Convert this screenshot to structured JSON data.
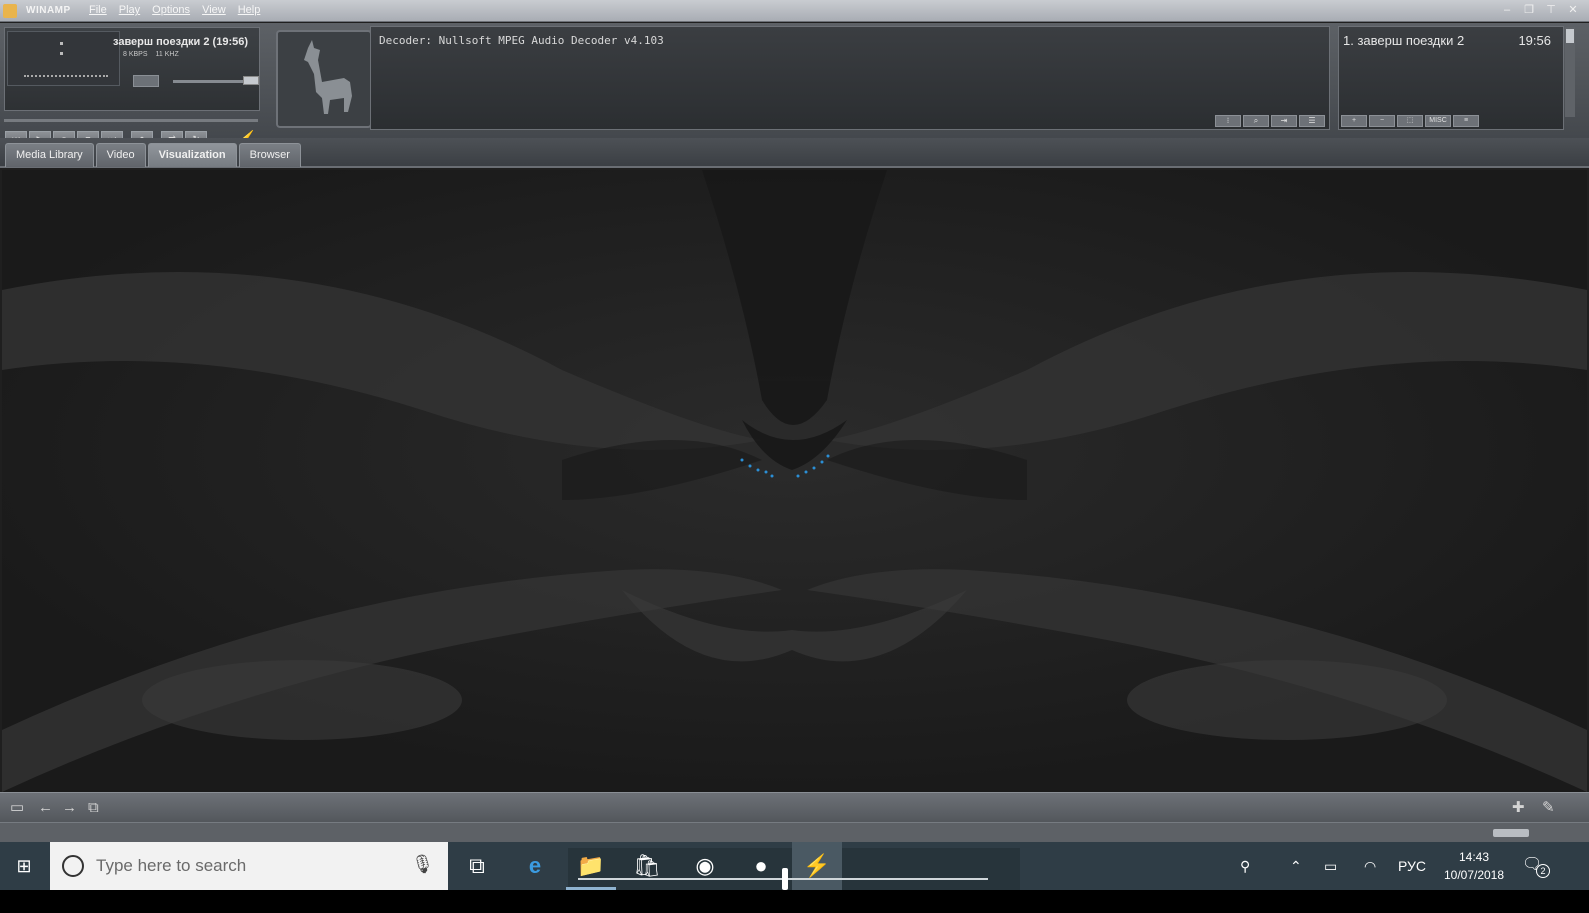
{
  "window": {
    "app_name": "WINAMP",
    "menu": [
      "File",
      "Play",
      "Options",
      "View",
      "Help"
    ]
  },
  "player": {
    "song_title": "заверш поездки 2 (19:56)",
    "kbps": "8 KBPS",
    "khz": "11 KHZ",
    "decoder_text": "Decoder: Nullsoft MPEG Audio Decoder v4.103"
  },
  "playlist": {
    "item": "1. заверш поездки 2",
    "time": "19:56",
    "misc_label": "MISC"
  },
  "tabs": [
    {
      "label": "Media Library"
    },
    {
      "label": "Video"
    },
    {
      "label": "Visualization"
    },
    {
      "label": "Browser"
    }
  ],
  "active_tab": "Visualization",
  "taskbar": {
    "search_placeholder": "Type here to search",
    "language": "РУС",
    "time": "14:43",
    "date": "10/07/2018",
    "notification_count": "2"
  },
  "colors": {
    "skin_dark": "#2e3134",
    "skin_mid": "#5d6166",
    "taskbar": "#2f3d46",
    "viz_dots": "#2b8fd6"
  }
}
